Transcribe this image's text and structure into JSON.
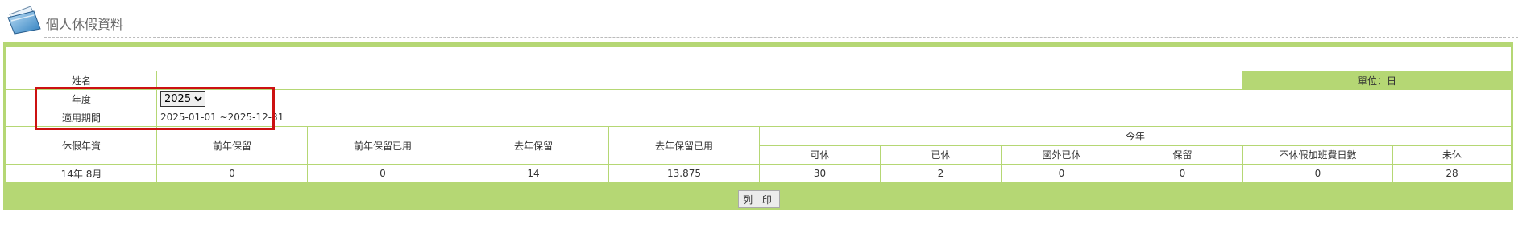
{
  "page": {
    "title": "個人休假資料"
  },
  "form": {
    "name_label": "姓名",
    "name_value": "",
    "unit_label": "單位：日",
    "year_label": "年度",
    "year_selected": "2025",
    "period_label": "適用期間",
    "period_value": "2025-01-01 ~2025-12-31"
  },
  "table": {
    "headers": {
      "seniority": "休假年資",
      "prev_year_reserved": "前年保留",
      "prev_year_reserved_used": "前年保留已用",
      "last_year_reserved": "去年保留",
      "last_year_reserved_used": "去年保留已用",
      "this_year": "今年",
      "available": "可休",
      "taken": "已休",
      "abroad_taken": "國外已休",
      "reserved": "保留",
      "unused_paid_days": "不休假加班費日數",
      "not_taken": "未休"
    },
    "row": {
      "seniority": "14年 8月",
      "prev_year_reserved": "0",
      "prev_year_reserved_used": "0",
      "last_year_reserved": "14",
      "last_year_reserved_used": "13.875",
      "available": "30",
      "taken": "2",
      "abroad_taken": "0",
      "reserved": "0",
      "unused_paid_days": "0",
      "not_taken": "28"
    }
  },
  "actions": {
    "print_label": "列 印"
  },
  "icons": {
    "logo": "card-folder-icon"
  },
  "colors": {
    "accent": "#b5d774",
    "highlight": "#cc1111"
  }
}
